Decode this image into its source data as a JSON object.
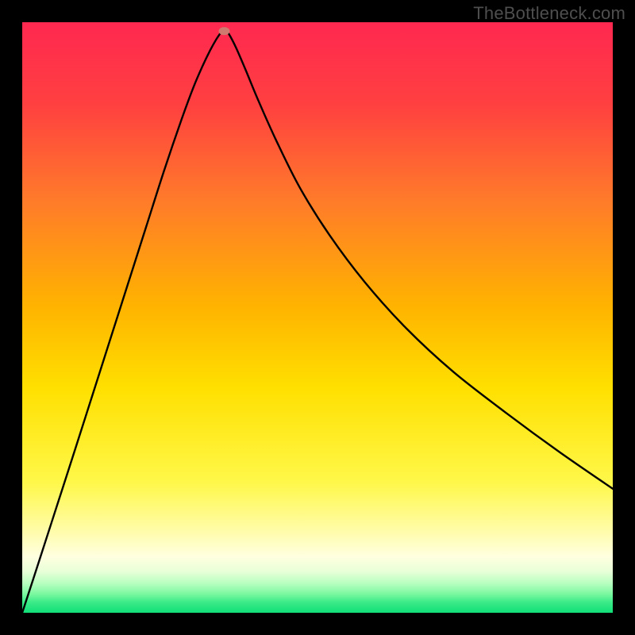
{
  "watermark": "TheBottleneck.com",
  "chart_data": {
    "type": "line",
    "title": "",
    "xlabel": "",
    "ylabel": "",
    "xlim": [
      0,
      1
    ],
    "ylim": [
      0,
      1
    ],
    "gradient": {
      "stops": [
        {
          "offset": 0.0,
          "color": "#ff2850"
        },
        {
          "offset": 0.14,
          "color": "#ff4040"
        },
        {
          "offset": 0.3,
          "color": "#ff7a2a"
        },
        {
          "offset": 0.48,
          "color": "#ffb300"
        },
        {
          "offset": 0.62,
          "color": "#ffe000"
        },
        {
          "offset": 0.78,
          "color": "#fff84a"
        },
        {
          "offset": 0.86,
          "color": "#fffca8"
        },
        {
          "offset": 0.905,
          "color": "#ffffe0"
        },
        {
          "offset": 0.93,
          "color": "#e8ffd8"
        },
        {
          "offset": 0.95,
          "color": "#b8ffc0"
        },
        {
          "offset": 0.968,
          "color": "#7cf8a0"
        },
        {
          "offset": 0.982,
          "color": "#3ceb88"
        },
        {
          "offset": 1.0,
          "color": "#10df78"
        }
      ]
    },
    "marker": {
      "x": 0.342,
      "y": 0.985,
      "color": "#cf7a6e"
    },
    "series": [
      {
        "name": "curve",
        "x": [
          0.0,
          0.03,
          0.06,
          0.09,
          0.12,
          0.15,
          0.18,
          0.21,
          0.24,
          0.27,
          0.29,
          0.305,
          0.318,
          0.328,
          0.336,
          0.342,
          0.35,
          0.362,
          0.378,
          0.4,
          0.43,
          0.47,
          0.52,
          0.58,
          0.65,
          0.73,
          0.82,
          0.91,
          1.0
        ],
        "y": [
          0.0,
          0.092,
          0.185,
          0.278,
          0.372,
          0.466,
          0.56,
          0.654,
          0.748,
          0.836,
          0.89,
          0.925,
          0.952,
          0.97,
          0.982,
          0.99,
          0.98,
          0.957,
          0.92,
          0.867,
          0.8,
          0.72,
          0.64,
          0.56,
          0.482,
          0.408,
          0.338,
          0.272,
          0.21
        ]
      }
    ]
  }
}
